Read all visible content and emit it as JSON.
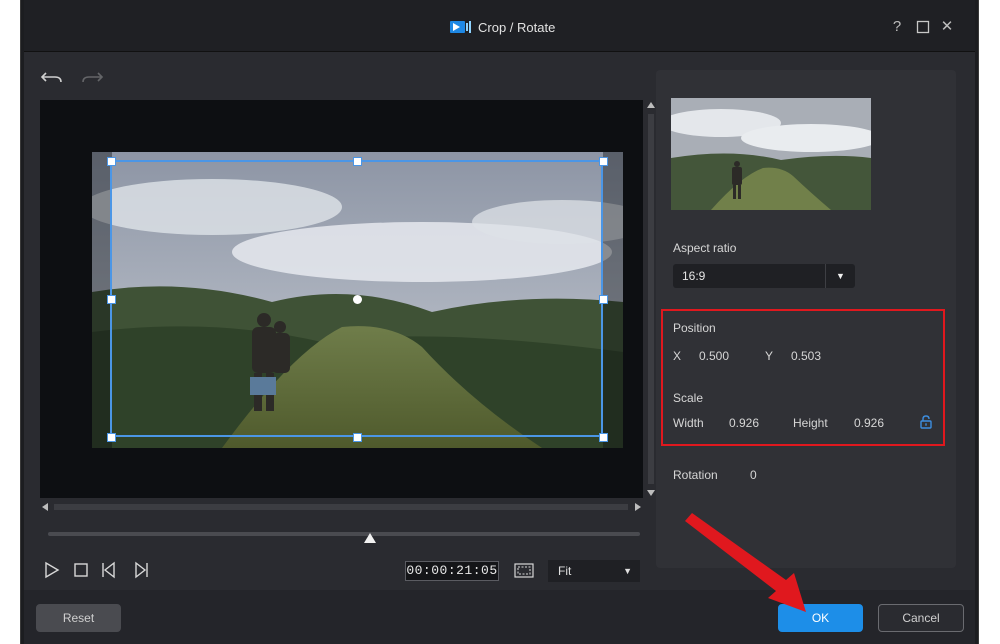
{
  "window": {
    "title": "Crop / Rotate",
    "help_glyph": "?",
    "close_glyph": "✕"
  },
  "player": {
    "timecode": "00:00:21:05",
    "zoom": "Fit"
  },
  "panel": {
    "aspect_ratio_label": "Aspect ratio",
    "aspect_ratio_value": "16:9",
    "position_label": "Position",
    "x_label": "X",
    "x_value": "0.500",
    "y_label": "Y",
    "y_value": "0.503",
    "scale_label": "Scale",
    "width_label": "Width",
    "width_value": "0.926",
    "height_label": "Height",
    "height_value": "0.926",
    "rotation_label": "Rotation",
    "rotation_value": "0"
  },
  "footer": {
    "reset_label": "Reset",
    "ok_label": "OK",
    "cancel_label": "Cancel"
  },
  "colors": {
    "accent": "#1d8ee8",
    "crop_border": "#4b96e6",
    "highlight": "#e0181e"
  },
  "icons": [
    "app-logo-icon",
    "help-icon",
    "maximize-icon",
    "close-icon",
    "undo-icon",
    "redo-icon",
    "play-icon",
    "stop-icon",
    "previous-frame-icon",
    "next-frame-icon",
    "safe-zone-icon",
    "chevron-down-icon",
    "lock-icon"
  ]
}
